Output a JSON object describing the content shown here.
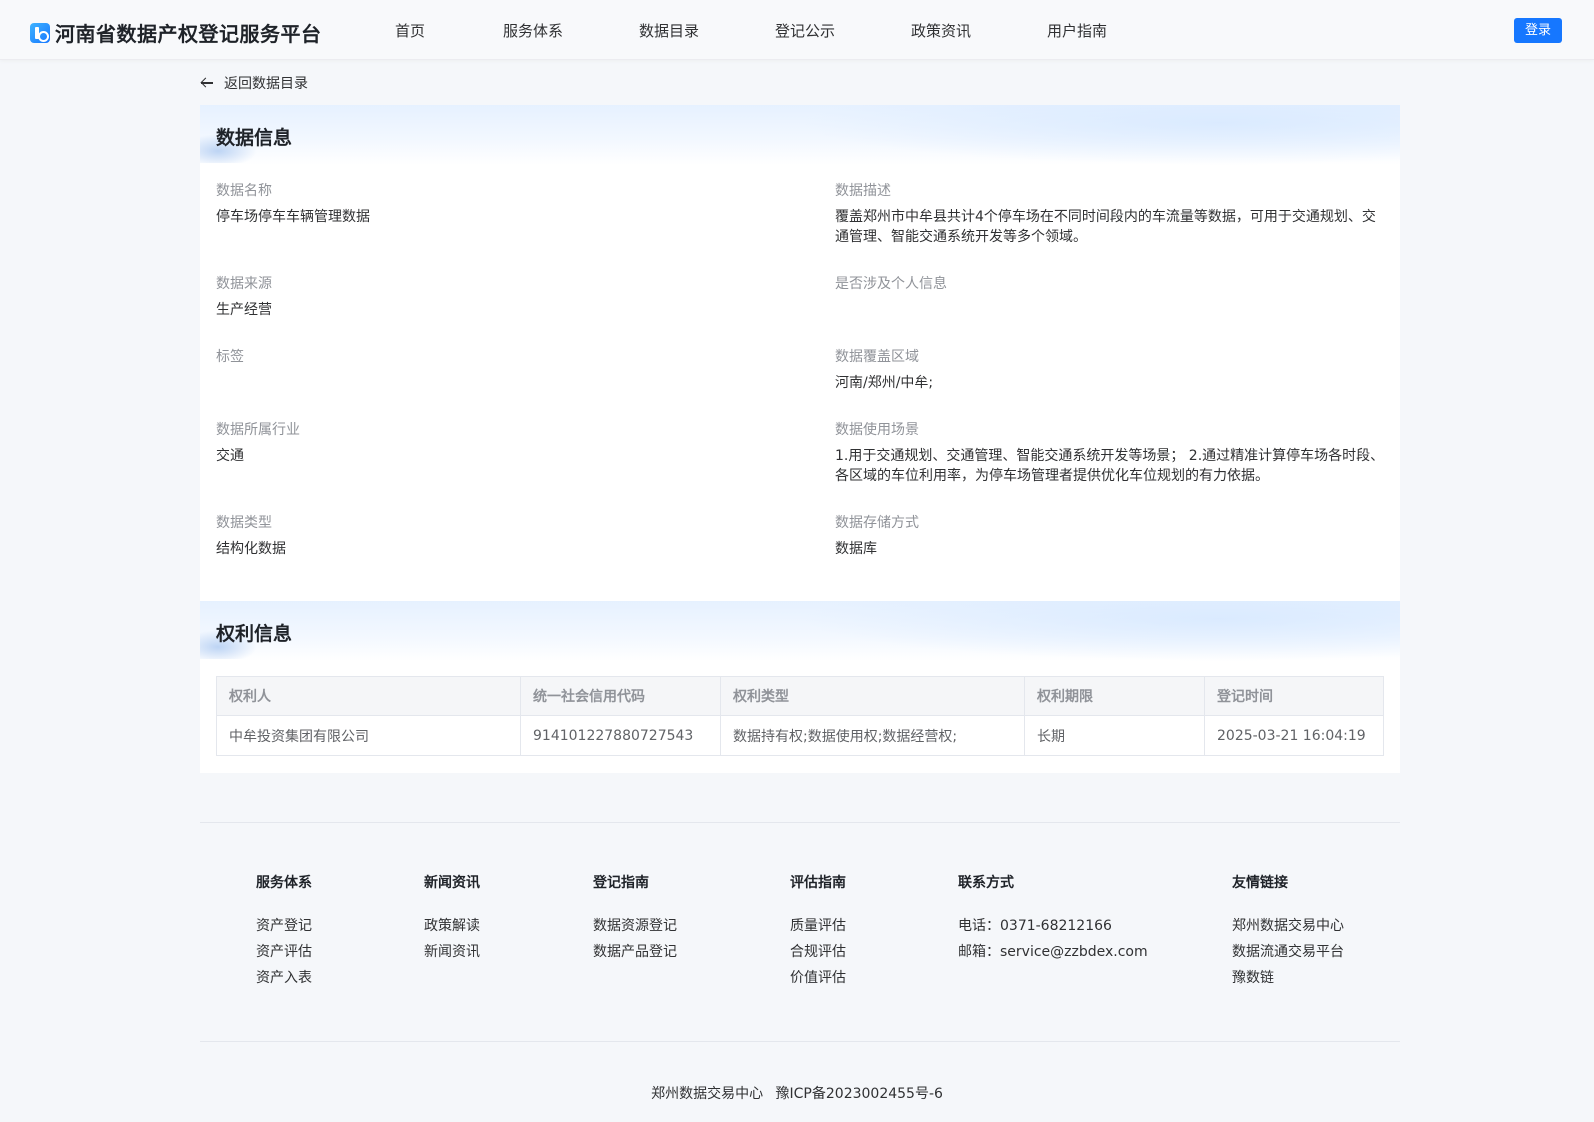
{
  "header": {
    "title": "河南省数据产权登记服务平台",
    "nav": [
      "首页",
      "服务体系",
      "数据目录",
      "登记公示",
      "政策资讯",
      "用户指南"
    ],
    "login_label": "登录"
  },
  "back_label": "返回数据目录",
  "data_info": {
    "title": "数据信息",
    "fields": [
      {
        "label": "数据名称",
        "value": "停车场停车车辆管理数据"
      },
      {
        "label": "数据描述",
        "value": "覆盖郑州市中牟县共计4个停车场在不同时间段内的车流量等数据，可用于交通规划、交通管理、智能交通系统开发等多个领域。"
      },
      {
        "label": "数据来源",
        "value": "生产经营"
      },
      {
        "label": "是否涉及个人信息",
        "value": ""
      },
      {
        "label": "标签",
        "value": ""
      },
      {
        "label": "数据覆盖区域",
        "value": "河南/郑州/中牟;"
      },
      {
        "label": "数据所属行业",
        "value": "交通"
      },
      {
        "label": "数据使用场景",
        "value": "1.用于交通规划、交通管理、智能交通系统开发等场景； 2.通过精准计算停车场各时段、各区域的车位利用率，为停车场管理者提供优化车位规划的有力依据。"
      },
      {
        "label": "数据类型",
        "value": "结构化数据"
      },
      {
        "label": "数据存储方式",
        "value": "数据库"
      }
    ]
  },
  "rights_info": {
    "title": "权利信息",
    "columns": [
      "权利人",
      "统一社会信用代码",
      "权利类型",
      "权利期限",
      "登记时间"
    ],
    "rows": [
      [
        "中牟投资集团有限公司",
        "914101227880727543",
        "数据持有权;数据使用权;数据经营权;",
        "长期",
        "2025-03-21 16:04:19"
      ]
    ]
  },
  "footer": {
    "columns": [
      {
        "title": "服务体系",
        "items": [
          "资产登记",
          "资产评估",
          "资产入表"
        ]
      },
      {
        "title": "新闻资讯",
        "items": [
          "政策解读",
          "新闻资讯"
        ]
      },
      {
        "title": "登记指南",
        "items": [
          "数据资源登记",
          "数据产品登记"
        ]
      },
      {
        "title": "评估指南",
        "items": [
          "质量评估",
          "合规评估",
          "价值评估"
        ]
      },
      {
        "title": "联系方式",
        "items": [
          "电话：0371-68212166",
          "邮箱：service@zzbdex.com"
        ]
      },
      {
        "title": "友情链接",
        "items": [
          "郑州数据交易中心",
          "数据流通交易平台",
          "豫数链"
        ]
      }
    ],
    "org": "郑州数据交易中心",
    "icp": "豫ICP备2023002455号-6"
  }
}
